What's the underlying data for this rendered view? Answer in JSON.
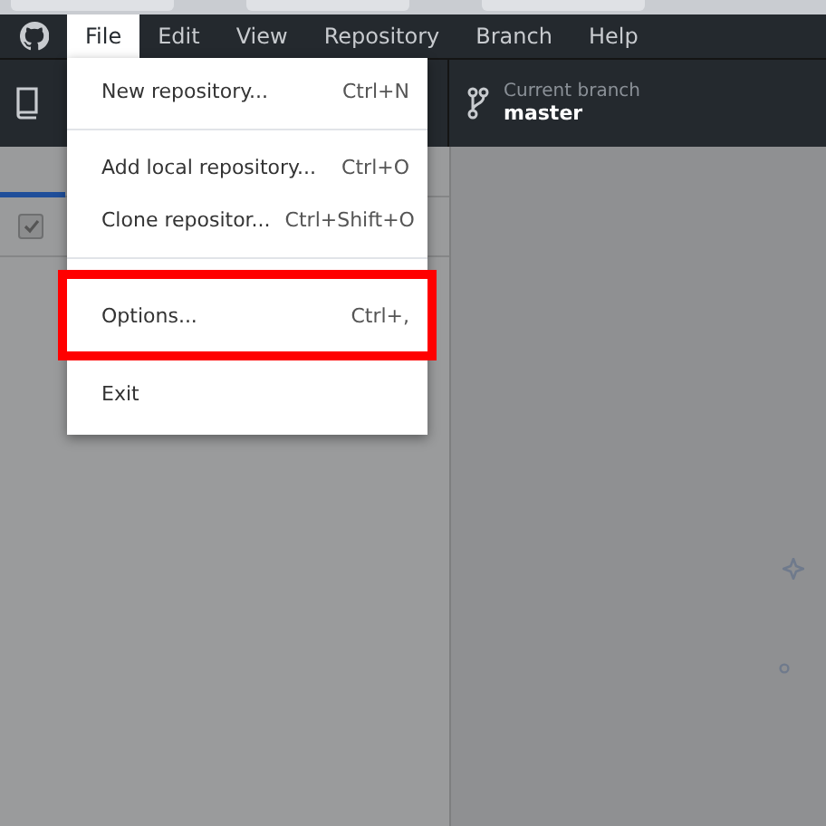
{
  "menu_bar": [
    {
      "label": "File",
      "selected": true
    },
    {
      "label": "Edit",
      "selected": false
    },
    {
      "label": "View",
      "selected": false
    },
    {
      "label": "Repository",
      "selected": false
    },
    {
      "label": "Branch",
      "selected": false
    },
    {
      "label": "Help",
      "selected": false
    }
  ],
  "toolbar": {
    "branch": {
      "label": "Current branch",
      "value": "master"
    }
  },
  "changes": {
    "select_all_checked": true
  },
  "file_menu": [
    {
      "kind": "item",
      "label": "New repository...",
      "shortcut": "Ctrl+N",
      "highlighted": false
    },
    {
      "kind": "separator"
    },
    {
      "kind": "item",
      "label": "Add local repository...",
      "shortcut": "Ctrl+O",
      "highlighted": false
    },
    {
      "kind": "item",
      "label": "Clone repositor...",
      "shortcut": "Ctrl+Shift+O",
      "highlighted": false
    },
    {
      "kind": "separator"
    },
    {
      "kind": "item",
      "label": "Options...",
      "shortcut": "Ctrl+,",
      "highlighted": true
    },
    {
      "kind": "item",
      "label": "Exit",
      "highlighted": false
    }
  ]
}
